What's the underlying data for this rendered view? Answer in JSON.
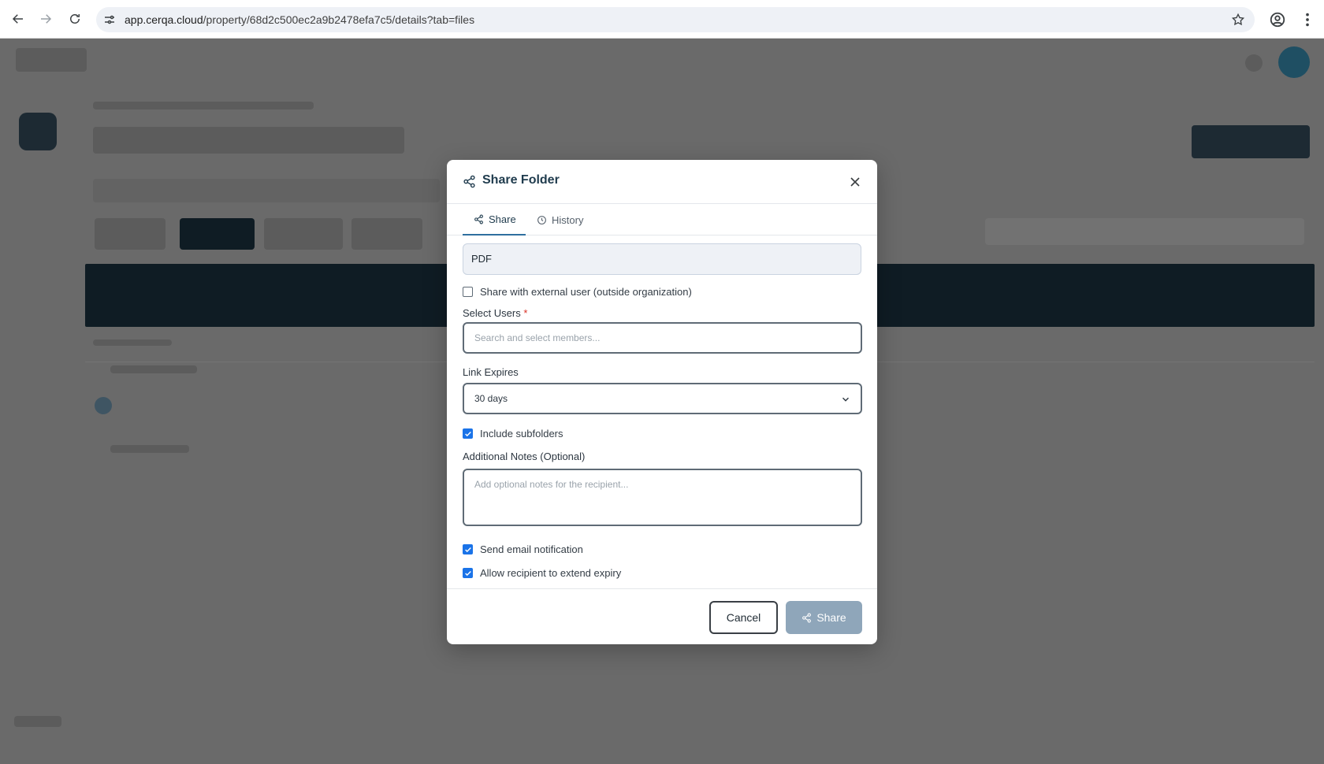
{
  "browser": {
    "url_host": "app.cerqa.cloud",
    "url_path": "/property/68d2c500ec2a9b2478efa7c5/details?tab=files"
  },
  "modal": {
    "title": "Share Folder",
    "tabs": [
      {
        "label": "Share",
        "active": true
      },
      {
        "label": "History",
        "active": false
      }
    ],
    "folder_name": "PDF",
    "external_user_label": "Share with external user (outside organization)",
    "external_user_checked": false,
    "select_users_label": "Select Users",
    "required_marker": "*",
    "select_users_placeholder": "Search and select members...",
    "link_expires_label": "Link Expires",
    "link_expires_value": "30 days",
    "include_subfolders_label": "Include subfolders",
    "include_subfolders_checked": true,
    "notes_label": "Additional Notes (Optional)",
    "notes_placeholder": "Add optional notes for the recipient...",
    "send_email_label": "Send email notification",
    "send_email_checked": true,
    "allow_extend_label": "Allow recipient to extend expiry",
    "allow_extend_checked": true,
    "cancel_label": "Cancel",
    "share_label": "Share"
  },
  "colors": {
    "accent": "#1a73e8",
    "title": "#1f3b4d",
    "share_button": "#8fa6ba",
    "overlay": "#6b6b6b"
  }
}
